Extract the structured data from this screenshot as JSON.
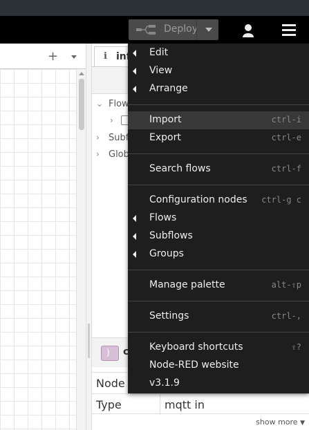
{
  "header": {
    "deploy_label": "Deploy"
  },
  "workspace": {
    "add_flow_glyph": "+"
  },
  "sidebar": {
    "tab_label": "info",
    "tree": {
      "flows": "Flows",
      "subflows": "Subflows",
      "globals": "Global"
    },
    "node_title": "c",
    "props": [
      {
        "key": "Node",
        "value": ""
      },
      {
        "key": "Type",
        "value": "mqtt in"
      }
    ],
    "show_more": "show more"
  },
  "menu": {
    "edit": "Edit",
    "view": "View",
    "arrange": "Arrange",
    "import": "Import",
    "import_sc": "ctrl-i",
    "export": "Export",
    "export_sc": "ctrl-e",
    "search": "Search flows",
    "search_sc": "ctrl-f",
    "config_nodes": "Configuration nodes",
    "config_nodes_sc": "ctrl-g c",
    "flows": "Flows",
    "subflows": "Subflows",
    "groups": "Groups",
    "manage_palette": "Manage palette",
    "manage_palette_sc": "alt-⇧p",
    "settings": "Settings",
    "settings_sc": "ctrl-,",
    "keyboard_shortcuts": "Keyboard shortcuts",
    "keyboard_shortcuts_sc": "⇧?",
    "website": "Node-RED website",
    "version": "v3.1.9"
  },
  "colors": {
    "header_bg": "#000000",
    "menu_bg": "#1e1e1e",
    "menu_active_bg": "#383838",
    "deploy_bg": "#4a4a4a",
    "node_icon_bg": "#d8bfd8"
  },
  "icons": [
    "deploy-icon",
    "user-icon",
    "menu-icon",
    "info-icon",
    "chevron-right-icon",
    "chevron-down-icon",
    "mqtt-icon",
    "plus-icon",
    "caret-down-icon"
  ]
}
